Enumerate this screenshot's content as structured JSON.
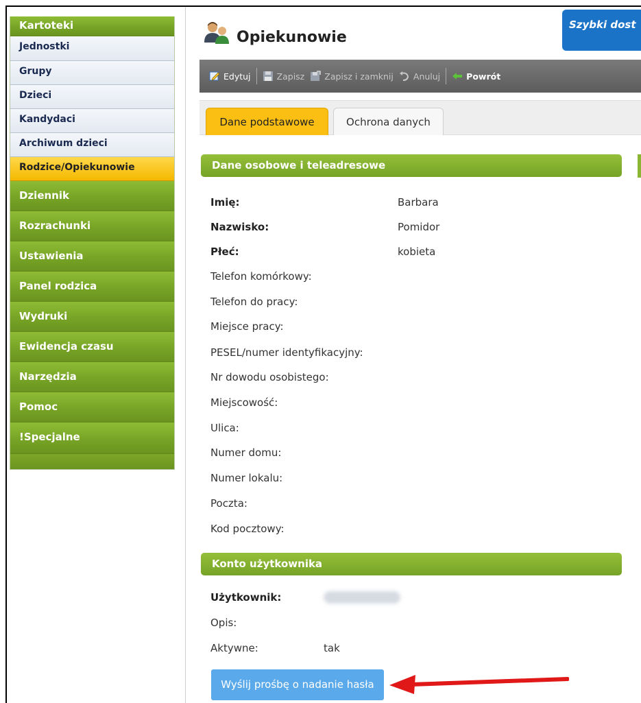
{
  "sidebar": {
    "header": "Kartoteki",
    "sub_items": [
      "Jednostki",
      "Grupy",
      "Dzieci",
      "Kandydaci",
      "Archiwum dzieci",
      "Rodzice/Opiekunowie"
    ],
    "active_item": "Rodzice/Opiekunowie",
    "main_items": [
      "Dziennik",
      "Rozrachunki",
      "Ustawienia",
      "Panel rodzica",
      "Wydruki",
      "Ewidencja czasu",
      "Narzędzia",
      "Pomoc",
      "!Specjalne"
    ]
  },
  "header": {
    "title": "Opiekunowie",
    "icon": "user-group-icon",
    "quick_access": "Szybki dost"
  },
  "toolbar": {
    "edit": "Edytuj",
    "save": "Zapisz",
    "save_close": "Zapisz i zamknij",
    "cancel": "Anuluj",
    "back": "Powrót"
  },
  "tabs": [
    "Dane podstawowe",
    "Ochrona danych"
  ],
  "personal": {
    "section_title": "Dane osobowe i teleadresowe",
    "fields": [
      {
        "label": "Imię:",
        "value": "Barbara"
      },
      {
        "label": "Nazwisko:",
        "value": "Pomidor"
      },
      {
        "label": "Płeć:",
        "value": "kobieta"
      },
      {
        "label": "Telefon komórkowy:",
        "value": ""
      },
      {
        "label": "Telefon do pracy:",
        "value": ""
      },
      {
        "label": "Miejsce pracy:",
        "value": ""
      },
      {
        "label": "PESEL/numer identyfikacyjny:",
        "value": ""
      },
      {
        "label": "Nr dowodu osobistego:",
        "value": ""
      },
      {
        "label": "Miejscowość:",
        "value": ""
      },
      {
        "label": "Ulica:",
        "value": ""
      },
      {
        "label": "Numer domu:",
        "value": ""
      },
      {
        "label": "Numer lokalu:",
        "value": ""
      },
      {
        "label": "Poczta:",
        "value": ""
      },
      {
        "label": "Kod pocztowy:",
        "value": ""
      }
    ]
  },
  "account": {
    "section_title": "Konto użytkownika",
    "user_label": "Użytkownik:",
    "description_label": "Opis:",
    "active_label": "Aktywne:",
    "active_value": "tak",
    "send_button": "Wyślij prośbę o nadanie hasła"
  },
  "colors": {
    "sidebar_green": "#7ea628",
    "active_yellow": "#fbbf13",
    "quick_blue": "#1a73c7",
    "button_blue": "#5aa9ea",
    "arrow_red": "#e01818"
  }
}
